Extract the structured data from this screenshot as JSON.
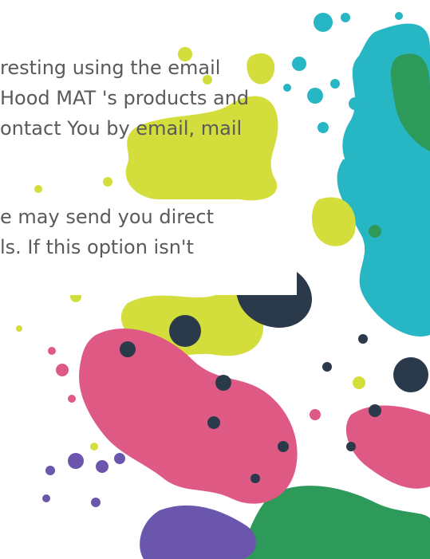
{
  "paragraph_one": {
    "lines": [
      "resting using the email",
      "Hood MAT 's products and",
      "ontact You by email, mail"
    ]
  },
  "paragraph_two": {
    "lines": [
      "e may send you direct",
      "ls. If this option isn't"
    ]
  },
  "palette": {
    "yellow_green": "#d3dd3c",
    "teal": "#27b6c4",
    "pink": "#de5a85",
    "navy": "#2b3a4a",
    "green": "#2e9a5a",
    "purple": "#6a56ad",
    "text": "#5a5a5a"
  }
}
